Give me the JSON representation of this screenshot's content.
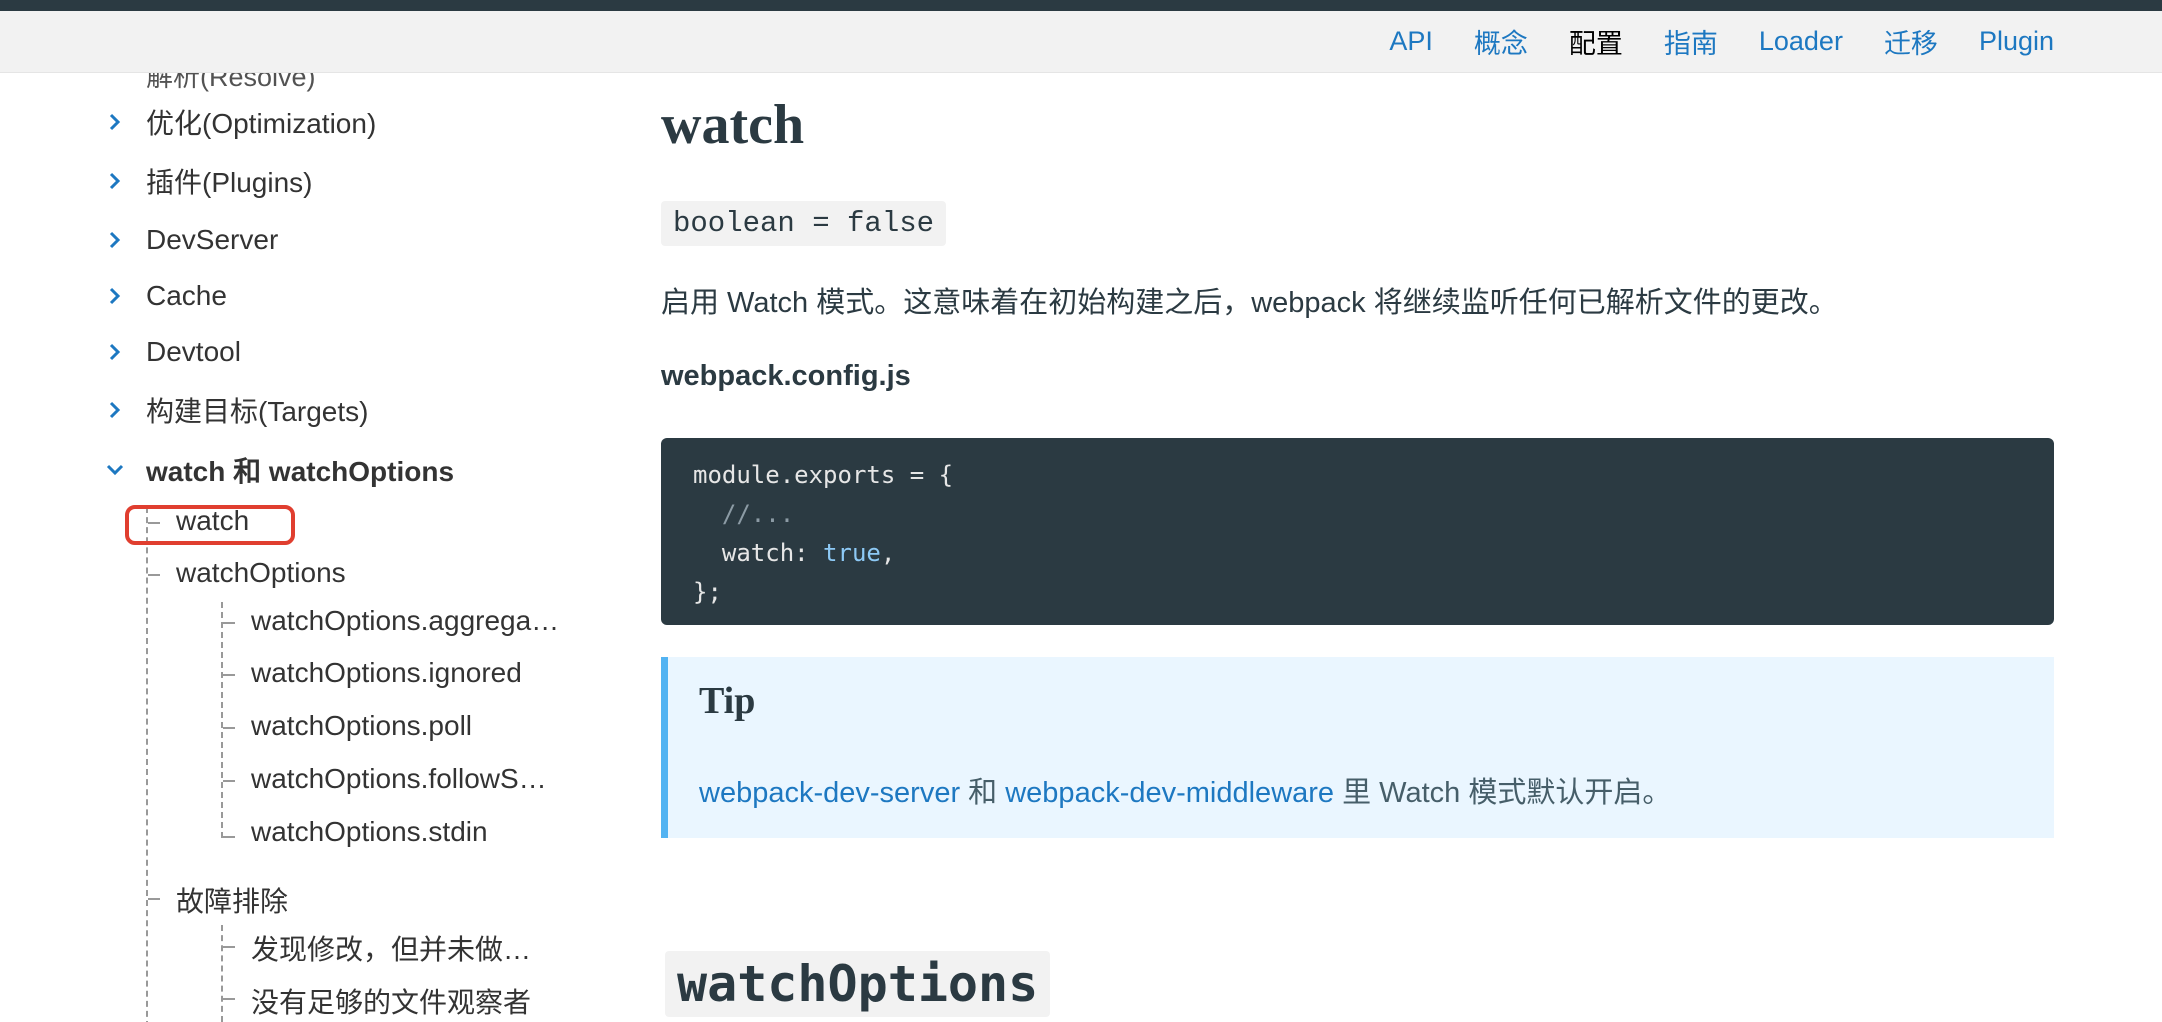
{
  "nav": {
    "items": [
      {
        "label": "API"
      },
      {
        "label": "概念"
      },
      {
        "label": "配置",
        "active": true
      },
      {
        "label": "指南"
      },
      {
        "label": "Loader"
      },
      {
        "label": "迁移"
      },
      {
        "label": "Plugin"
      }
    ]
  },
  "sidebar": {
    "cut_item": "解析(Resolve)",
    "sections": [
      {
        "label": "优化(Optimization)"
      },
      {
        "label": "插件(Plugins)"
      },
      {
        "label": "DevServer"
      },
      {
        "label": "Cache"
      },
      {
        "label": "Devtool"
      },
      {
        "label": "构建目标(Targets)"
      },
      {
        "label": "watch 和 watchOptions"
      }
    ],
    "sub": {
      "watch": "watch",
      "watchOptions": "watchOptions",
      "aggregate": "watchOptions.aggrega…",
      "ignored": "watchOptions.ignored",
      "poll": "watchOptions.poll",
      "followSymlinks": "watchOptions.followS…",
      "stdin": "watchOptions.stdin",
      "troubleshooting": "故障排除",
      "changes_not_built": "发现修改，但并未做…",
      "not_enough_watchers": "没有足够的文件观察者"
    }
  },
  "main": {
    "title": "watch",
    "type_sig": "boolean = false",
    "description": "启用 Watch 模式。这意味着在初始构建之后，webpack 将继续监听任何已解析文件的更改。",
    "file_label": "webpack.config.js",
    "code": {
      "line1": "module.exports = {",
      "line2": "  //...",
      "line3_key": "  watch: ",
      "line3_val": "true",
      "line3_end": ",",
      "line4": "};"
    },
    "tip": {
      "title": "Tip",
      "link1": "webpack-dev-server",
      "mid": " 和 ",
      "link2": "webpack-dev-middleware",
      "rest": " 里 Watch 模式默认开启。"
    },
    "next_heading": "watchOptions"
  },
  "colors": {
    "link": "#1d78c1",
    "dark": "#2b3a42",
    "tip_bg": "#eaf6ff",
    "tip_border": "#52b3f2",
    "highlight": "#e03e2f"
  }
}
